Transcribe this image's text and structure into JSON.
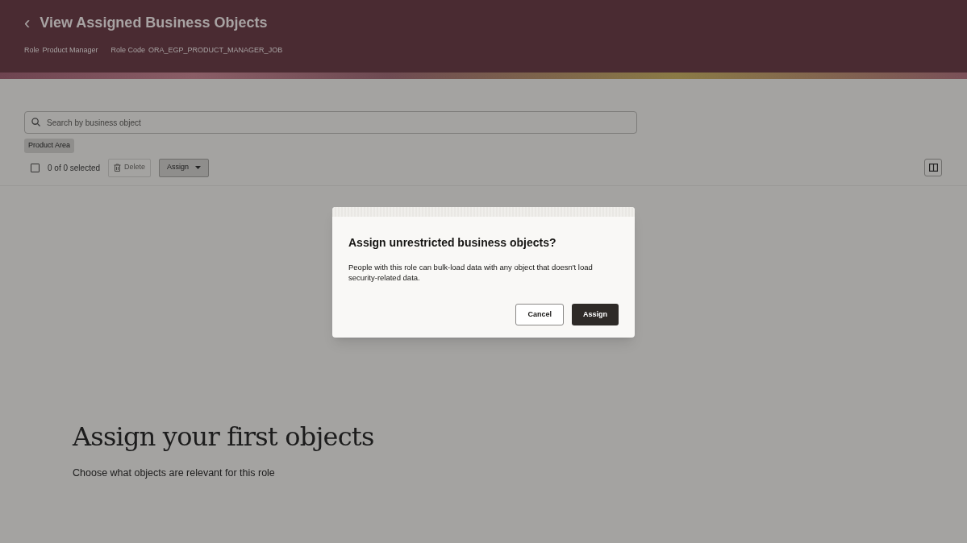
{
  "header": {
    "back_icon": "‹",
    "title": "View Assigned Business Objects",
    "role_label": "Role",
    "role_value": "Product Manager",
    "role_code_label": "Role Code",
    "role_code_value": "ORA_EGP_PRODUCT_MANAGER_JOB"
  },
  "search": {
    "placeholder": "Search by business object"
  },
  "filters": [
    {
      "label": "Product Area"
    }
  ],
  "toolbar": {
    "select_all": {
      "checked": false
    },
    "selection_text": "0 of 0 selected",
    "delete": {
      "label": "Delete",
      "disabled": true
    },
    "assign": {
      "label": "Assign"
    }
  },
  "empty_state": {
    "title": "Assign your first objects",
    "subtitle": "Choose what objects are relevant for this role"
  },
  "dialog": {
    "title": "Assign unrestricted business objects?",
    "message": "People with this role can bulk-load data with any object that doesn't load security-related data.",
    "buttons": [
      {
        "label": "Cancel",
        "kind": "secondary"
      },
      {
        "label": "Assign",
        "kind": "primary"
      }
    ]
  }
}
